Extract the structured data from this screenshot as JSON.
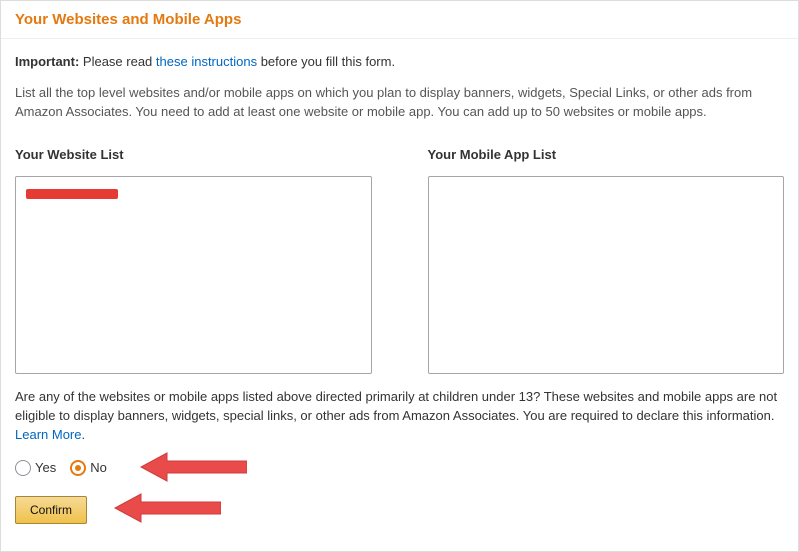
{
  "header": {
    "title": "Your Websites and Mobile Apps"
  },
  "important": {
    "label": "Important:",
    "pre": "Please read ",
    "link": "these instructions",
    "post": " before you fill this form."
  },
  "intro": "List all the top level websites and/or mobile apps on which you plan to display banners, widgets, Special Links, or other ads from Amazon Associates. You need to add at least one website or mobile app. You can add up to 50 websites or mobile apps.",
  "lists": {
    "website_label": "Your Website List",
    "mobile_label": "Your Mobile App List"
  },
  "question": {
    "text_pre": "Are any of the websites or mobile apps listed above directed primarily at children under 13? These websites and mobile apps are not eligible to display banners, widgets, special links, or other ads from Amazon Associates. You are required to declare this information. ",
    "learn_more": "Learn More",
    "text_post": "."
  },
  "radio": {
    "yes": "Yes",
    "no": "No",
    "selected": "no"
  },
  "confirm_label": "Confirm"
}
